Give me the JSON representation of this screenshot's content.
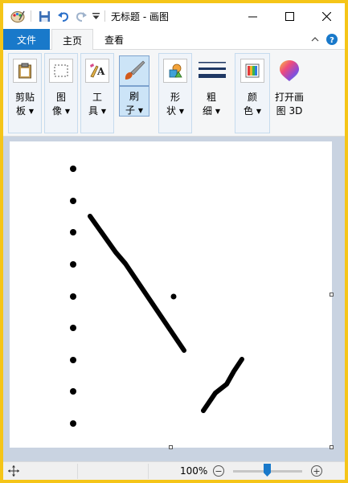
{
  "window": {
    "title": "无标题 - 画图"
  },
  "tabs": {
    "file": "文件",
    "home": "主页",
    "view": "查看"
  },
  "ribbon": {
    "groups": [
      {
        "line1": "剪贴",
        "line2": "板"
      },
      {
        "line1": "图",
        "line2": "像"
      },
      {
        "line1": "工",
        "line2": "具"
      },
      {
        "line1": "刷",
        "line2": "子"
      },
      {
        "line1": "形",
        "line2": "状"
      },
      {
        "line1": "粗",
        "line2": "细"
      },
      {
        "line1": "颜",
        "line2": "色"
      },
      {
        "line1": "打开画",
        "line2": "图 3D"
      }
    ]
  },
  "status": {
    "zoom": "100%"
  },
  "colors": {
    "accent": "#1979ca",
    "workspace": "#c9d3e1",
    "frame": "#f5c518"
  },
  "icons": [
    "paint-app-icon",
    "save-icon",
    "undo-icon",
    "redo-icon",
    "customize-icon",
    "minimize-icon",
    "maximize-icon",
    "close-icon",
    "collapse-ribbon-icon",
    "help-icon",
    "clipboard-icon",
    "select-icon",
    "tools-icon",
    "brush-icon",
    "shapes-icon",
    "size-icon",
    "colors-icon",
    "paint3d-icon",
    "move-icon",
    "zoom-out-icon",
    "zoom-in-icon"
  ]
}
